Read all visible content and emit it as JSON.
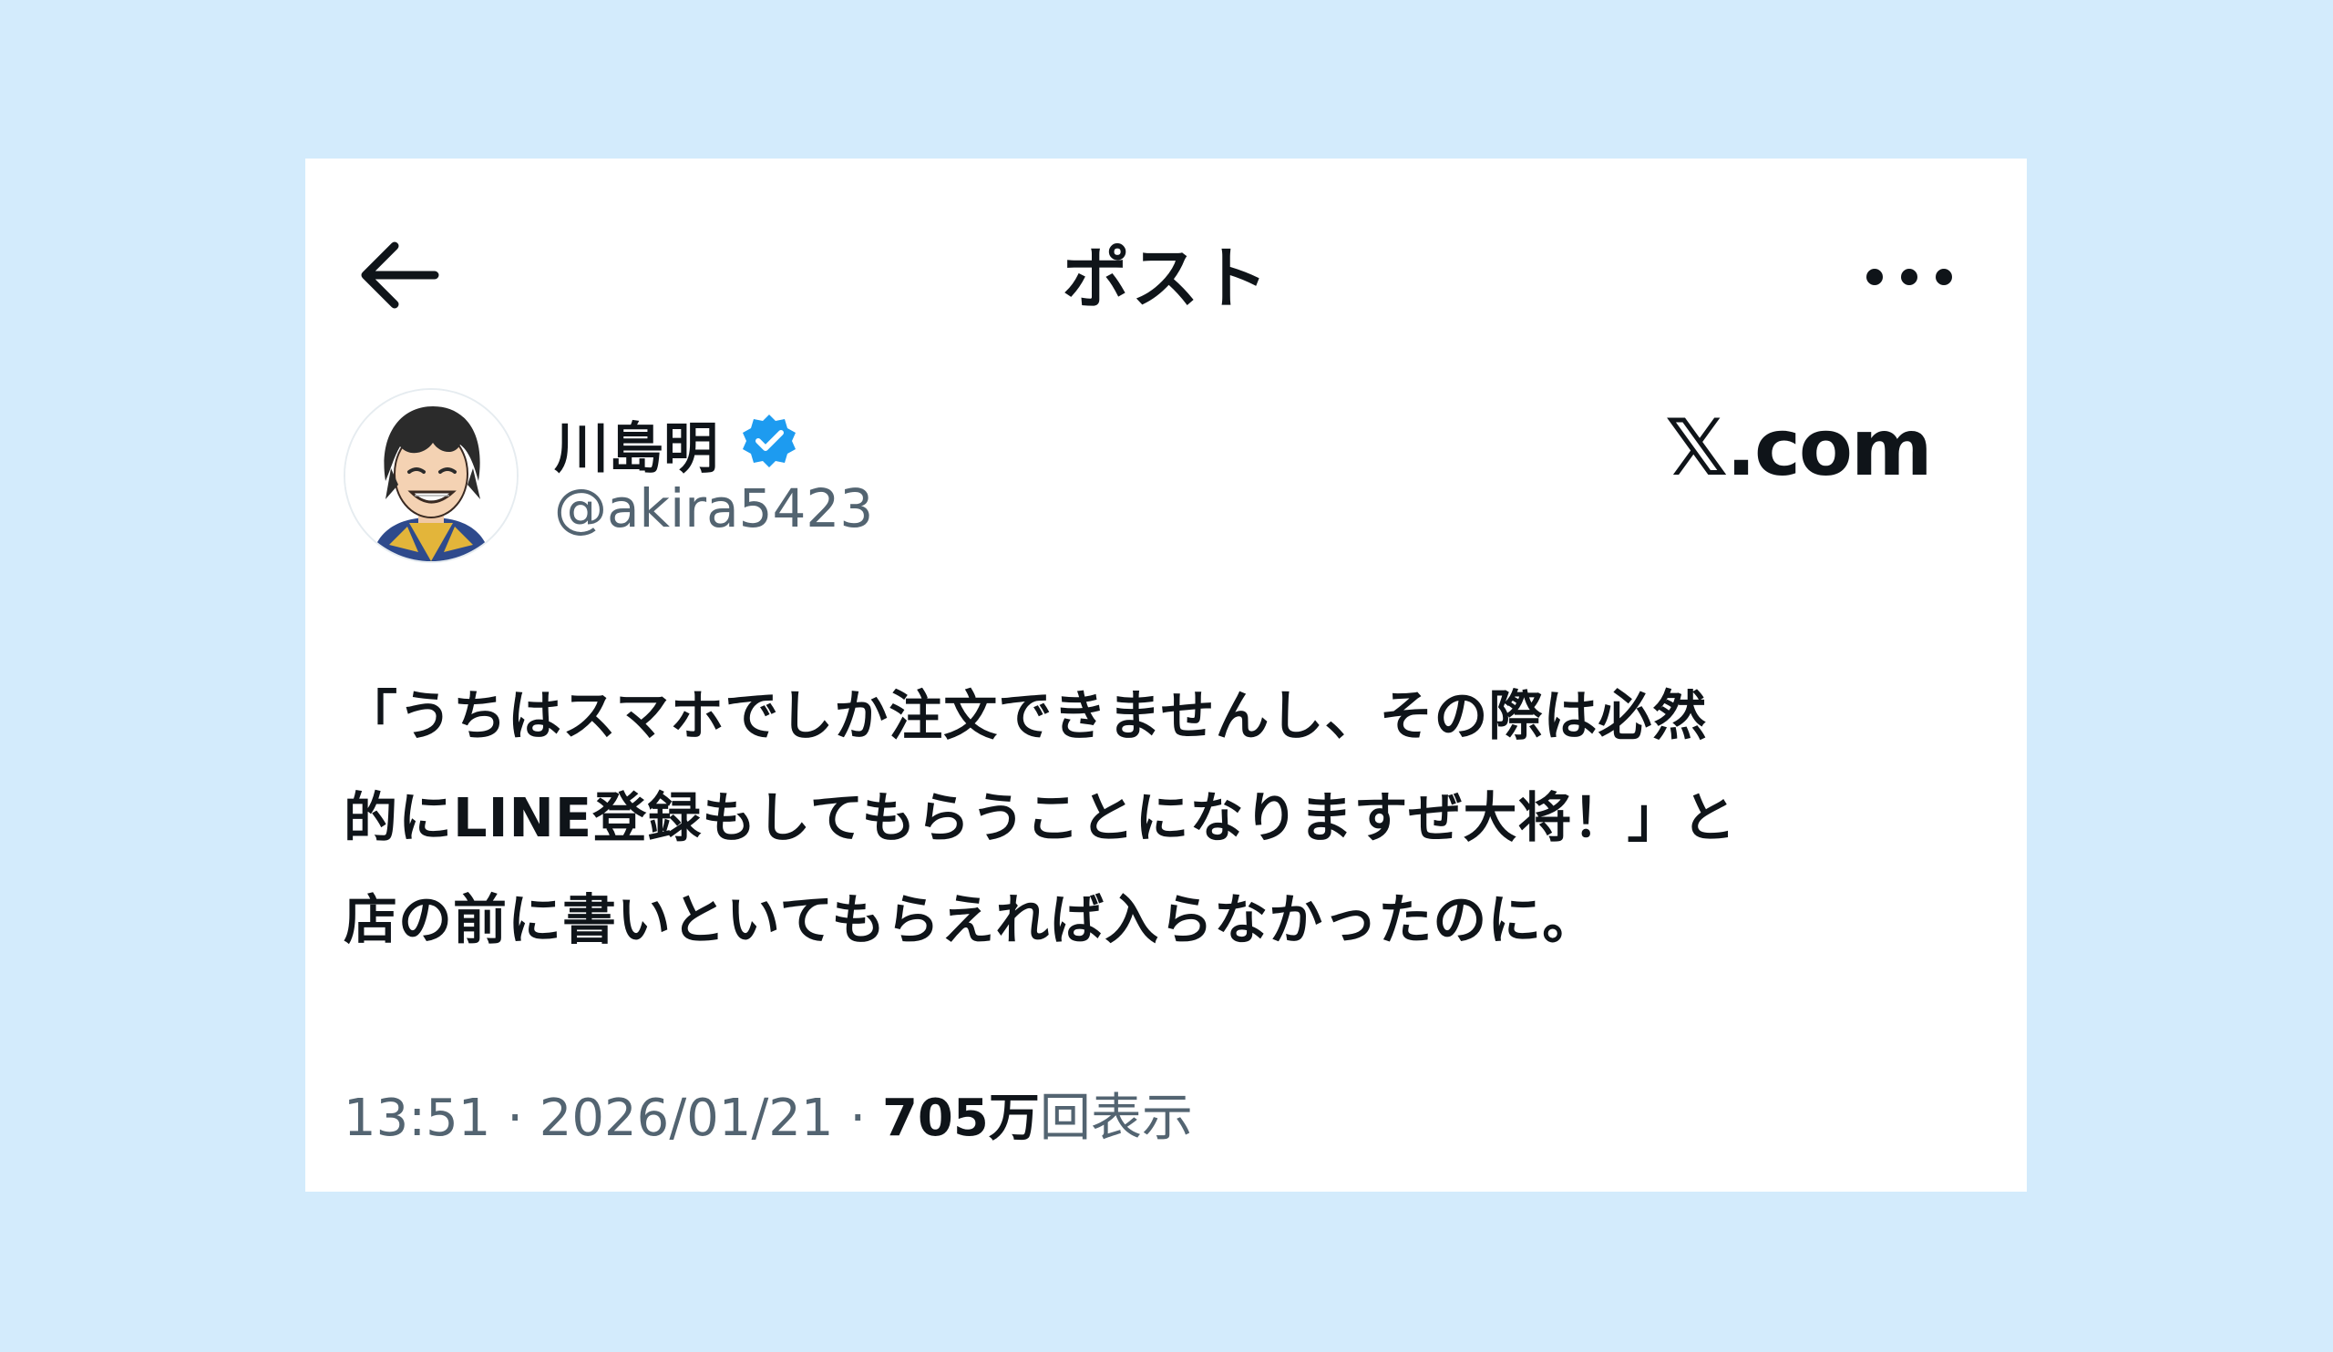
{
  "header": {
    "title": "ポスト",
    "back_icon": "arrow-left-icon",
    "more_icon": "more-horizontal-icon"
  },
  "author": {
    "display_name": "川島明",
    "handle": "@akira5423",
    "verified": true,
    "verified_color": "#1d9bf0"
  },
  "brand": {
    "text": "𝕏.com"
  },
  "post": {
    "text": "「うちはスマホでしか注文できませんし、その際は必然\n的にLINE登録もしてもらうことになりますぜ大将！」と\n店の前に書いといてもらえれば入らなかったのに。"
  },
  "meta": {
    "time": "13:51",
    "separator": " · ",
    "date": "2026/01/21",
    "views_count": "705万",
    "views_label": "回表示"
  },
  "colors": {
    "background": "#d3ebfc",
    "card": "#ffffff",
    "text_primary": "#0f1419",
    "text_secondary": "#536471"
  }
}
